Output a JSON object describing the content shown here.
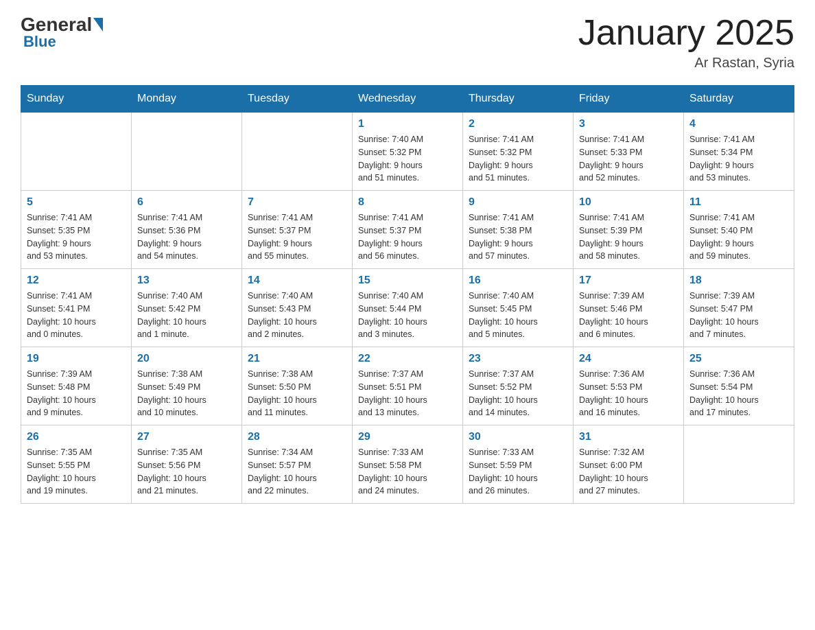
{
  "header": {
    "logo_general": "General",
    "logo_blue": "Blue",
    "title": "January 2025",
    "location": "Ar Rastan, Syria"
  },
  "days_of_week": [
    "Sunday",
    "Monday",
    "Tuesday",
    "Wednesday",
    "Thursday",
    "Friday",
    "Saturday"
  ],
  "weeks": [
    [
      {
        "day": "",
        "info": ""
      },
      {
        "day": "",
        "info": ""
      },
      {
        "day": "",
        "info": ""
      },
      {
        "day": "1",
        "info": "Sunrise: 7:40 AM\nSunset: 5:32 PM\nDaylight: 9 hours\nand 51 minutes."
      },
      {
        "day": "2",
        "info": "Sunrise: 7:41 AM\nSunset: 5:32 PM\nDaylight: 9 hours\nand 51 minutes."
      },
      {
        "day": "3",
        "info": "Sunrise: 7:41 AM\nSunset: 5:33 PM\nDaylight: 9 hours\nand 52 minutes."
      },
      {
        "day": "4",
        "info": "Sunrise: 7:41 AM\nSunset: 5:34 PM\nDaylight: 9 hours\nand 53 minutes."
      }
    ],
    [
      {
        "day": "5",
        "info": "Sunrise: 7:41 AM\nSunset: 5:35 PM\nDaylight: 9 hours\nand 53 minutes."
      },
      {
        "day": "6",
        "info": "Sunrise: 7:41 AM\nSunset: 5:36 PM\nDaylight: 9 hours\nand 54 minutes."
      },
      {
        "day": "7",
        "info": "Sunrise: 7:41 AM\nSunset: 5:37 PM\nDaylight: 9 hours\nand 55 minutes."
      },
      {
        "day": "8",
        "info": "Sunrise: 7:41 AM\nSunset: 5:37 PM\nDaylight: 9 hours\nand 56 minutes."
      },
      {
        "day": "9",
        "info": "Sunrise: 7:41 AM\nSunset: 5:38 PM\nDaylight: 9 hours\nand 57 minutes."
      },
      {
        "day": "10",
        "info": "Sunrise: 7:41 AM\nSunset: 5:39 PM\nDaylight: 9 hours\nand 58 minutes."
      },
      {
        "day": "11",
        "info": "Sunrise: 7:41 AM\nSunset: 5:40 PM\nDaylight: 9 hours\nand 59 minutes."
      }
    ],
    [
      {
        "day": "12",
        "info": "Sunrise: 7:41 AM\nSunset: 5:41 PM\nDaylight: 10 hours\nand 0 minutes."
      },
      {
        "day": "13",
        "info": "Sunrise: 7:40 AM\nSunset: 5:42 PM\nDaylight: 10 hours\nand 1 minute."
      },
      {
        "day": "14",
        "info": "Sunrise: 7:40 AM\nSunset: 5:43 PM\nDaylight: 10 hours\nand 2 minutes."
      },
      {
        "day": "15",
        "info": "Sunrise: 7:40 AM\nSunset: 5:44 PM\nDaylight: 10 hours\nand 3 minutes."
      },
      {
        "day": "16",
        "info": "Sunrise: 7:40 AM\nSunset: 5:45 PM\nDaylight: 10 hours\nand 5 minutes."
      },
      {
        "day": "17",
        "info": "Sunrise: 7:39 AM\nSunset: 5:46 PM\nDaylight: 10 hours\nand 6 minutes."
      },
      {
        "day": "18",
        "info": "Sunrise: 7:39 AM\nSunset: 5:47 PM\nDaylight: 10 hours\nand 7 minutes."
      }
    ],
    [
      {
        "day": "19",
        "info": "Sunrise: 7:39 AM\nSunset: 5:48 PM\nDaylight: 10 hours\nand 9 minutes."
      },
      {
        "day": "20",
        "info": "Sunrise: 7:38 AM\nSunset: 5:49 PM\nDaylight: 10 hours\nand 10 minutes."
      },
      {
        "day": "21",
        "info": "Sunrise: 7:38 AM\nSunset: 5:50 PM\nDaylight: 10 hours\nand 11 minutes."
      },
      {
        "day": "22",
        "info": "Sunrise: 7:37 AM\nSunset: 5:51 PM\nDaylight: 10 hours\nand 13 minutes."
      },
      {
        "day": "23",
        "info": "Sunrise: 7:37 AM\nSunset: 5:52 PM\nDaylight: 10 hours\nand 14 minutes."
      },
      {
        "day": "24",
        "info": "Sunrise: 7:36 AM\nSunset: 5:53 PM\nDaylight: 10 hours\nand 16 minutes."
      },
      {
        "day": "25",
        "info": "Sunrise: 7:36 AM\nSunset: 5:54 PM\nDaylight: 10 hours\nand 17 minutes."
      }
    ],
    [
      {
        "day": "26",
        "info": "Sunrise: 7:35 AM\nSunset: 5:55 PM\nDaylight: 10 hours\nand 19 minutes."
      },
      {
        "day": "27",
        "info": "Sunrise: 7:35 AM\nSunset: 5:56 PM\nDaylight: 10 hours\nand 21 minutes."
      },
      {
        "day": "28",
        "info": "Sunrise: 7:34 AM\nSunset: 5:57 PM\nDaylight: 10 hours\nand 22 minutes."
      },
      {
        "day": "29",
        "info": "Sunrise: 7:33 AM\nSunset: 5:58 PM\nDaylight: 10 hours\nand 24 minutes."
      },
      {
        "day": "30",
        "info": "Sunrise: 7:33 AM\nSunset: 5:59 PM\nDaylight: 10 hours\nand 26 minutes."
      },
      {
        "day": "31",
        "info": "Sunrise: 7:32 AM\nSunset: 6:00 PM\nDaylight: 10 hours\nand 27 minutes."
      },
      {
        "day": "",
        "info": ""
      }
    ]
  ]
}
